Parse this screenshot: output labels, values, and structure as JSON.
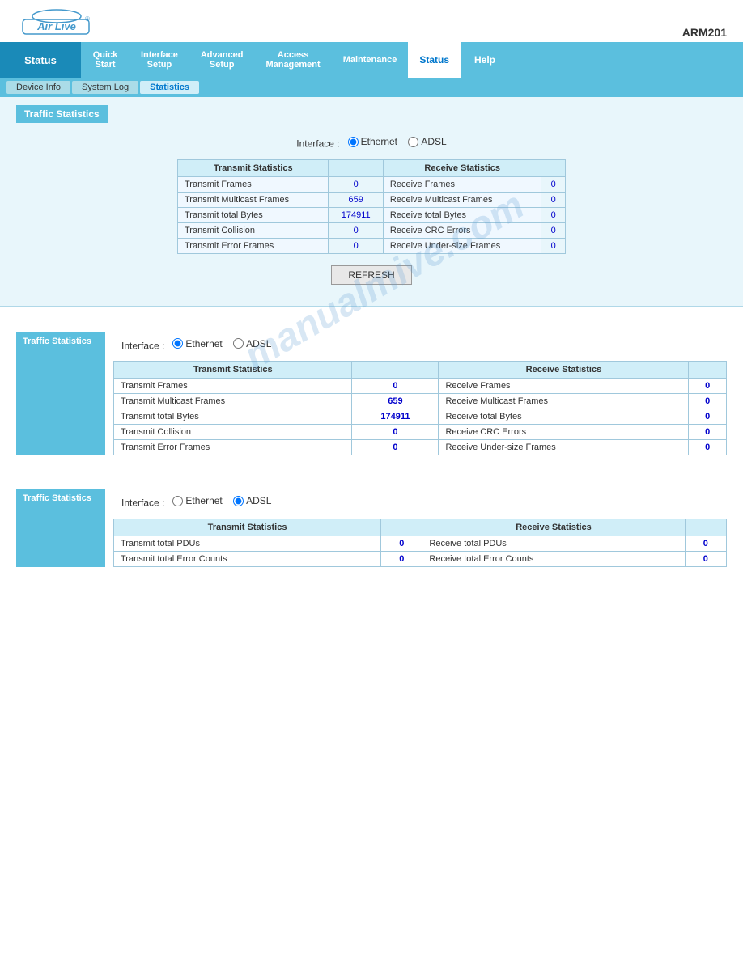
{
  "header": {
    "model": "ARM201",
    "logo_text": "Air Live"
  },
  "nav": {
    "items": [
      {
        "label": "Quick\nStart",
        "key": "quick-start"
      },
      {
        "label": "Interface\nSetup",
        "key": "interface-setup"
      },
      {
        "label": "Advanced\nSetup",
        "key": "advanced-setup"
      },
      {
        "label": "Access\nManagement",
        "key": "access-management"
      },
      {
        "label": "Maintenance",
        "key": "maintenance"
      },
      {
        "label": "Status",
        "key": "status",
        "active": true
      },
      {
        "label": "Help",
        "key": "help"
      }
    ],
    "status_label": "Status",
    "sub_items": [
      {
        "label": "Device Info",
        "key": "device-info"
      },
      {
        "label": "System Log",
        "key": "system-log"
      },
      {
        "label": "Statistics",
        "key": "statistics",
        "active": true
      }
    ]
  },
  "section1": {
    "title": "Traffic Statistics",
    "interface_label": "Interface :",
    "radio_ethernet_label": "Ethernet",
    "radio_adsl_label": "ADSL",
    "ethernet_selected": true,
    "transmit_header": "Transmit Statistics",
    "receive_header": "Receive Statistics",
    "rows": [
      {
        "tx_label": "Transmit Frames",
        "tx_value": "0",
        "rx_label": "Receive Frames",
        "rx_value": "0"
      },
      {
        "tx_label": "Transmit Multicast Frames",
        "tx_value": "659",
        "rx_label": "Receive Multicast Frames",
        "rx_value": "0"
      },
      {
        "tx_label": "Transmit total Bytes",
        "tx_value": "174911",
        "rx_label": "Receive total Bytes",
        "rx_value": "0"
      },
      {
        "tx_label": "Transmit Collision",
        "tx_value": "0",
        "rx_label": "Receive CRC Errors",
        "rx_value": "0"
      },
      {
        "tx_label": "Transmit Error Frames",
        "tx_value": "0",
        "rx_label": "Receive Under-size Frames",
        "rx_value": "0"
      }
    ],
    "refresh_btn": "REFRESH"
  },
  "section2": {
    "title": "Traffic Statistics",
    "interface_label": "Interface :",
    "radio_ethernet_label": "Ethernet",
    "radio_adsl_label": "ADSL",
    "ethernet_selected": true,
    "transmit_header": "Transmit Statistics",
    "receive_header": "Receive Statistics",
    "rows": [
      {
        "tx_label": "Transmit Frames",
        "tx_value": "0",
        "rx_label": "Receive Frames",
        "rx_value": "0"
      },
      {
        "tx_label": "Transmit Multicast Frames",
        "tx_value": "659",
        "rx_label": "Receive Multicast Frames",
        "rx_value": "0"
      },
      {
        "tx_label": "Transmit total Bytes",
        "tx_value": "174911",
        "rx_label": "Receive total Bytes",
        "rx_value": "0"
      },
      {
        "tx_label": "Transmit Collision",
        "tx_value": "0",
        "rx_label": "Receive CRC Errors",
        "rx_value": "0"
      },
      {
        "tx_label": "Transmit Error Frames",
        "tx_value": "0",
        "rx_label": "Receive Under-size Frames",
        "rx_value": "0"
      }
    ]
  },
  "section3": {
    "title": "Traffic Statistics",
    "interface_label": "Interface :",
    "radio_ethernet_label": "Ethernet",
    "radio_adsl_label": "ADSL",
    "adsl_selected": true,
    "transmit_header": "Transmit Statistics",
    "receive_header": "Receive Statistics",
    "rows": [
      {
        "tx_label": "Transmit total PDUs",
        "tx_value": "0",
        "rx_label": "Receive total PDUs",
        "rx_value": "0"
      },
      {
        "tx_label": "Transmit total Error Counts",
        "tx_value": "0",
        "rx_label": "Receive total Error Counts",
        "rx_value": "0"
      }
    ]
  },
  "watermark": "manualmive.com"
}
